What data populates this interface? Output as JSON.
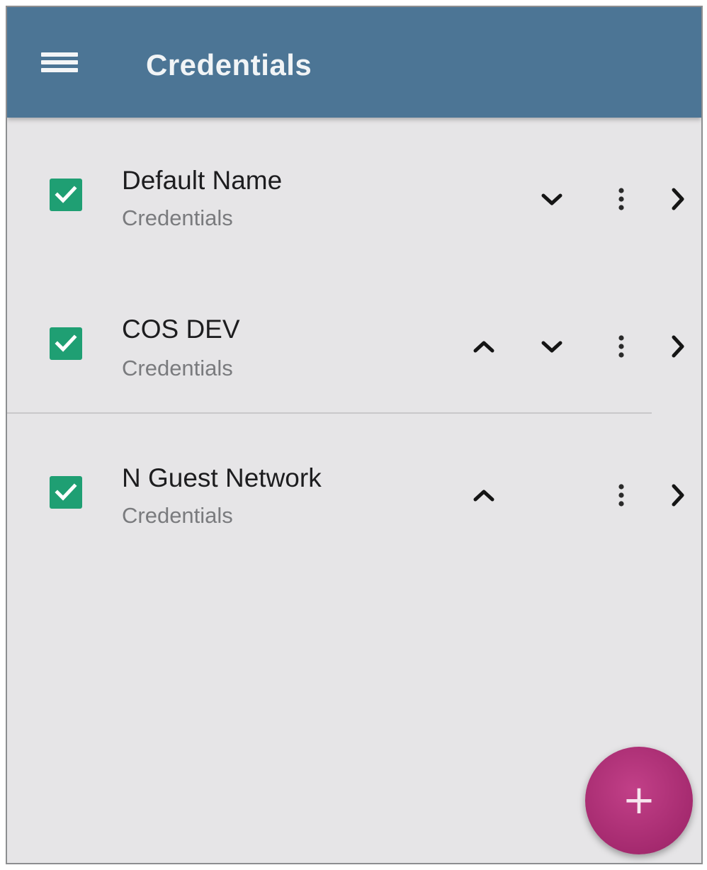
{
  "appbar": {
    "title": "Credentials",
    "menu_icon": "hamburger-menu-icon"
  },
  "list": {
    "items": [
      {
        "title": "Default Name",
        "subtitle": "Credentials",
        "checked": true,
        "controls": [
          "move-down-icon",
          "more-vert-icon",
          "chevron-right-icon"
        ]
      },
      {
        "title": "COS DEV",
        "subtitle": "Credentials",
        "checked": true,
        "controls": [
          "move-up-icon",
          "move-down-icon",
          "more-vert-icon",
          "chevron-right-icon"
        ]
      },
      {
        "title": "N Guest Network",
        "subtitle": "Credentials",
        "checked": true,
        "controls": [
          "move-up-icon",
          "more-vert-icon",
          "chevron-right-icon"
        ]
      }
    ]
  },
  "fab": {
    "symbol": "+",
    "icon": "add-icon"
  },
  "colors": {
    "appbar": "#4c7595",
    "checkbox": "#1f9f73",
    "fab": "#a52a6f",
    "background": "#e6e5e7"
  }
}
